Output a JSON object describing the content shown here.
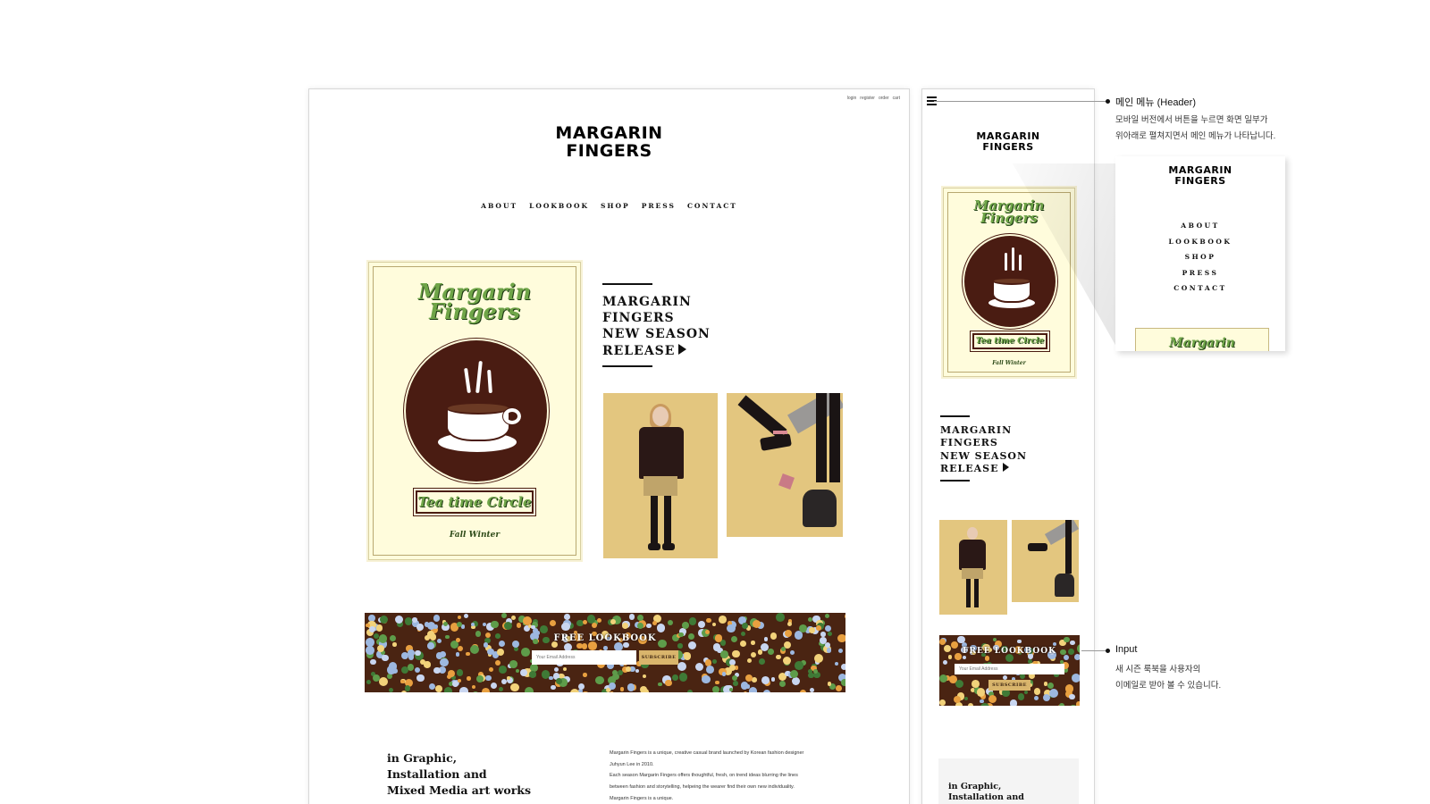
{
  "brand": {
    "line1": "MARGARIN",
    "line2": "FINGERS"
  },
  "util_links": [
    "login",
    "register",
    "order",
    "cart"
  ],
  "nav": [
    "ABOUT",
    "LOOKBOOK",
    "SHOP",
    "PRESS",
    "CONTACT"
  ],
  "poster": {
    "script_line1": "Margarin",
    "script_line2": "Fingers",
    "tag": "Tea time Circle",
    "season": "Fall Winter"
  },
  "release": {
    "line1": "MARGARIN",
    "line2": "FINGERS",
    "line3": "NEW SEASON",
    "line4": "RELEASE"
  },
  "newsletter": {
    "title": "FREE LOOKBOOK",
    "placeholder": "Your Email Address",
    "button": "SUBSCRIBE"
  },
  "about": {
    "heading1": "in Graphic,",
    "heading2": "Installation and",
    "heading3": "Mixed Media art works",
    "text1": "Margarin Fingers is a unique, creative casual brand launched by Korean fashion designer",
    "text2": "Juhyun Lee in 2010.",
    "text3": "Each season Margarin Fingers offers thoughtful, fresh, on trend ideas blurring the lines",
    "text4": "between fashion and storytelling, helpeing the wearer find their own new individuality.",
    "text5": "Margarin Fingers is a unique."
  },
  "mobile_popup": {
    "poster_script": "Margarin"
  },
  "annotations": {
    "header_title": "메인 메뉴 (Header)",
    "header_desc1": "모바일 버전에서 버튼을 누르면 화면 일부가",
    "header_desc2": "위아래로 펼쳐지면서 메인 메뉴가 나타납니다.",
    "input_title": "Input",
    "input_desc1": "새 시즌 룩북을 사용자의",
    "input_desc2": "이메일로 받아 볼 수 있습니다."
  },
  "colors": {
    "coffee_brown": "#4a1c12",
    "cream": "#fffcdc",
    "script_green": "#6fa548",
    "photo_mustard": "#e3c67f",
    "subscribe_gold": "#d9b56c"
  },
  "icons": [
    "hamburger-menu-icon",
    "play-arrow-icon",
    "coffee-cup-icon"
  ]
}
